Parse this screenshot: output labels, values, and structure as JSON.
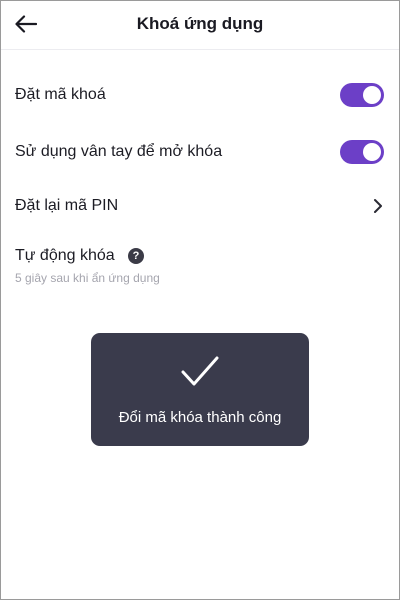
{
  "header": {
    "title": "Khoá ứng dụng",
    "back_icon": "arrow-left-icon"
  },
  "settings": {
    "set_lock_code": {
      "label": "Đặt mã khoá",
      "enabled": true
    },
    "fingerprint_unlock": {
      "label": "Sử dụng vân tay để mở khóa",
      "enabled": true
    },
    "reset_pin": {
      "label": "Đặt lại mã PIN",
      "icon": "chevron-right-icon"
    },
    "auto_lock": {
      "label": "Tự động khóa",
      "help_glyph": "?",
      "subtitle": "5 giây sau khi ẩn ứng dụng"
    }
  },
  "toast": {
    "message": "Đổi mã khóa thành công",
    "icon": "checkmark-icon"
  },
  "colors": {
    "accent": "#6c3fc7",
    "toast_bg": "#3a3b4c",
    "subtitle": "#a5a5ae"
  }
}
